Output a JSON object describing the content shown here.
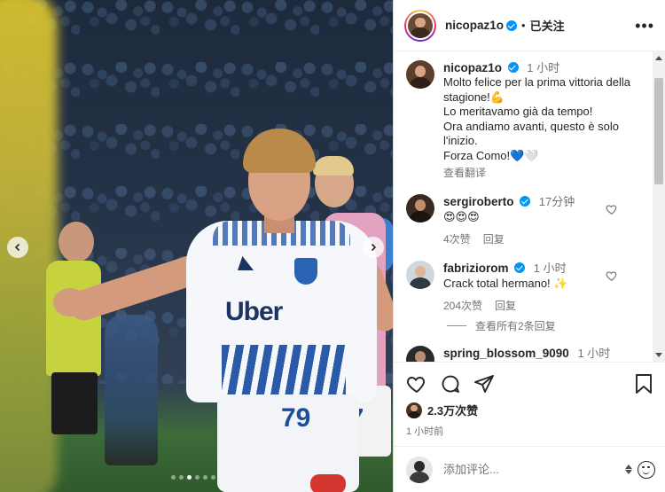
{
  "header": {
    "username": "nicopaz1o",
    "separator": "•",
    "follow_state": "已关注",
    "more_icon": "more-horizontal-icon"
  },
  "caption": {
    "username": "nicopaz1o",
    "time": "1 小时",
    "text": "Molto felice per la prima vittoria della stagione!💪\nLo meritavamo già da tempo!\nOra andiamo avanti, questo è solo l'inizio.\nForza Como!💙🤍",
    "see_translation": "查看翻译"
  },
  "comments": [
    {
      "username": "sergiroberto",
      "time": "17分钟",
      "text": "😍😍😍",
      "likes": "4次赞",
      "reply": "回复"
    },
    {
      "username": "fabriziorom",
      "time": "1 小时",
      "text": "Crack total hermano! ✨",
      "likes": "204次赞",
      "reply": "回复",
      "view_replies": "查看所有2条回复"
    },
    {
      "username": "spring_blossom_9090",
      "time": "1 小时"
    }
  ],
  "actions": {
    "like_icon": "heart-icon",
    "comment_icon": "comment-icon",
    "share_icon": "send-icon",
    "save_icon": "bookmark-icon"
  },
  "likes": {
    "count": "2.3万次赞"
  },
  "post_time": "1 小时前",
  "comment_box": {
    "placeholder": "添加评论..."
  },
  "carousel": {
    "slide_count": 6,
    "active_index": 2
  },
  "colors": {
    "accent": "#0095f6",
    "muted": "#737373",
    "text": "#262626"
  }
}
